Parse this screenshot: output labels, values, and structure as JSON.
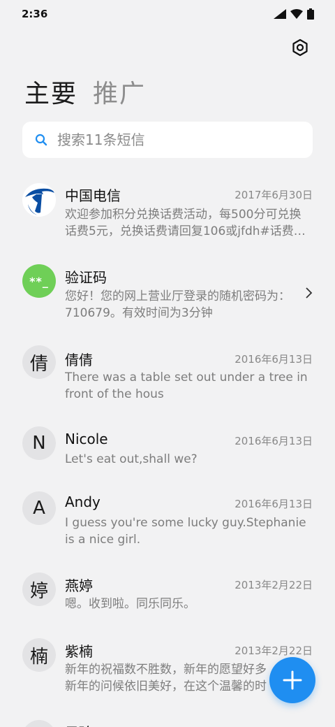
{
  "status_bar": {
    "time": "2:36",
    "icons": [
      "signal-icon",
      "wifi-icon",
      "battery-icon"
    ]
  },
  "header": {
    "settings_icon": "settings-icon"
  },
  "tabs": [
    {
      "label": "主要",
      "active": true
    },
    {
      "label": "推广",
      "active": false
    }
  ],
  "search": {
    "placeholder": "搜索11条短信",
    "value": ""
  },
  "messages": [
    {
      "name": "中国电信",
      "date": "2017年6月30日",
      "avatar": "china-telecom-logo",
      "preview": [
        "欢迎参加积分兑换话费活动，每500分可兑换",
        "话费5元，兑换话费请回复106或jfdh#话费…"
      ]
    },
    {
      "name": "验证码",
      "date": "",
      "avatar": "**_",
      "preview": [
        "您好！您的网上营业厅登录的随机密码为：",
        "710679。有效时间为3分钟"
      ]
    },
    {
      "name": "倩倩",
      "date": "2016年6月13日",
      "avatar": "倩",
      "preview": [
        "There was a table set out under a tree in",
        "front of the hous"
      ]
    },
    {
      "name": "Nicole",
      "date": "2016年6月13日",
      "avatar": "N",
      "preview": [
        "Let's eat out,shall we?"
      ]
    },
    {
      "name": "Andy",
      "date": "2016年6月13日",
      "avatar": "A",
      "preview": [
        "I guess you're some lucky guy.Stephanie",
        "is a nice girl."
      ]
    },
    {
      "name": "燕婷",
      "date": "2013年2月22日",
      "avatar": "婷",
      "preview": [
        "嗯。收到啦。同乐同乐。"
      ]
    },
    {
      "name": "紫楠",
      "date": "2013年2月22日",
      "avatar": "楠",
      "preview": [
        "新年的祝福数不胜数，新年的愿望好多",
        "新年的问候依旧美好，在这个温馨的时"
      ]
    },
    {
      "name": "子玲",
      "date": "",
      "avatar": "",
      "preview": []
    }
  ],
  "colors": {
    "accent": "#1f8ef1",
    "verify_green": "#6fcf57",
    "telecom_blue": "#0a4ea3"
  },
  "fab": {
    "icon": "plus-icon"
  }
}
